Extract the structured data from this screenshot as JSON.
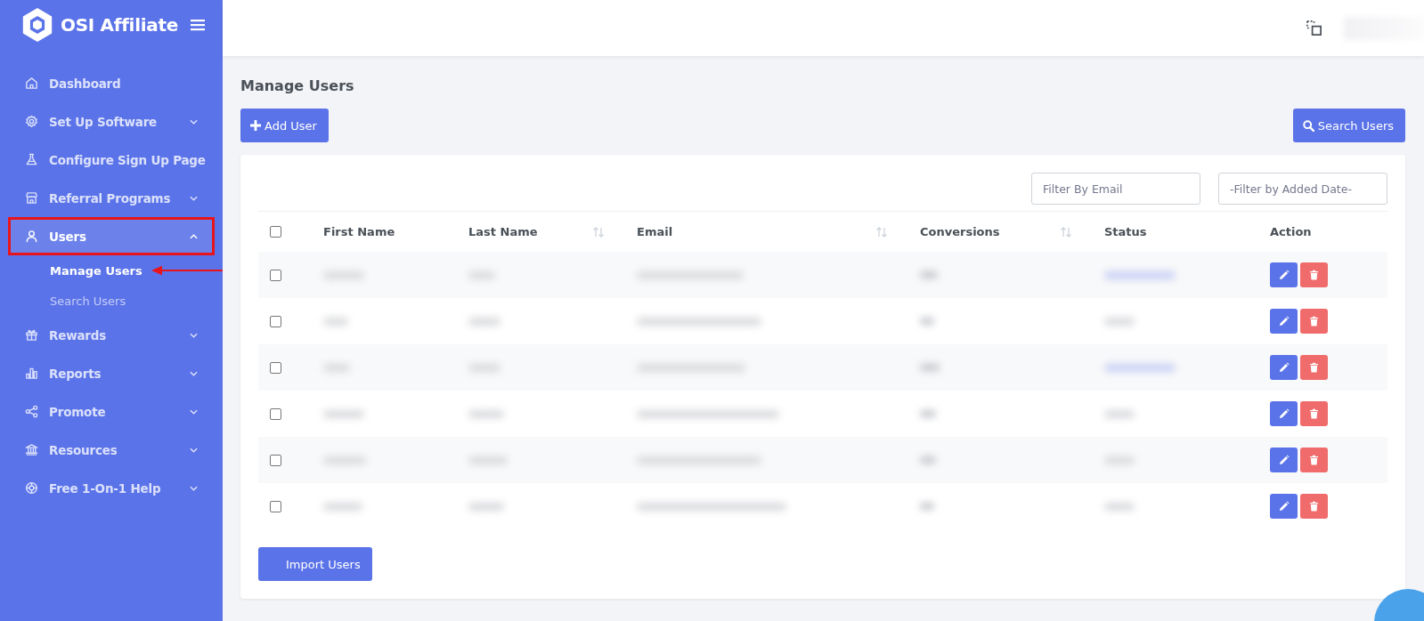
{
  "brand": {
    "name": "OSI Affiliate"
  },
  "sidebar": {
    "items": [
      {
        "label": "Dashboard",
        "selected": false,
        "annotated": false
      },
      {
        "label": "Set Up Software",
        "expanded": false,
        "selected": false,
        "annotated": false
      },
      {
        "label": "Configure Sign Up Page",
        "selected": false,
        "annotated": false
      },
      {
        "label": "Referral Programs",
        "expanded": false,
        "selected": false,
        "annotated": false
      },
      {
        "label": "Users",
        "expanded": true,
        "selected": true,
        "annotated": true,
        "children": [
          {
            "label": "Manage Users",
            "selected": true,
            "annotated": true
          },
          {
            "label": "Search Users",
            "selected": false,
            "annotated": false
          }
        ]
      },
      {
        "label": "Rewards",
        "expanded": false,
        "selected": false,
        "annotated": false
      },
      {
        "label": "Reports",
        "expanded": false,
        "selected": false,
        "annotated": false
      },
      {
        "label": "Promote",
        "expanded": false,
        "selected": false,
        "annotated": false
      },
      {
        "label": "Resources",
        "expanded": false,
        "selected": false,
        "annotated": false
      },
      {
        "label": "Free 1-On-1 Help",
        "expanded": false,
        "selected": false,
        "annotated": false
      }
    ]
  },
  "page": {
    "title": "Manage Users",
    "add_button": "Add User",
    "search_button": "Search Users"
  },
  "filters": {
    "email_placeholder": "Filter By Email",
    "date_placeholder": "-Filter by Added Date-"
  },
  "table": {
    "select_all_checked": false,
    "columns": [
      {
        "label": "First Name",
        "sortable": false
      },
      {
        "label": "Last Name",
        "sortable": true
      },
      {
        "label": "Email",
        "sortable": true
      },
      {
        "label": "Conversions",
        "sortable": true
      },
      {
        "label": "Status",
        "sortable": false
      },
      {
        "label": "Action",
        "sortable": false
      }
    ],
    "rows": [
      {
        "checked": false,
        "kind": "badge"
      },
      {
        "checked": false,
        "kind": "text"
      },
      {
        "checked": false,
        "kind": "badge"
      },
      {
        "checked": false,
        "kind": "text"
      },
      {
        "checked": false,
        "kind": "text"
      },
      {
        "checked": false,
        "kind": "text"
      }
    ]
  },
  "import_button": "Import Users"
}
